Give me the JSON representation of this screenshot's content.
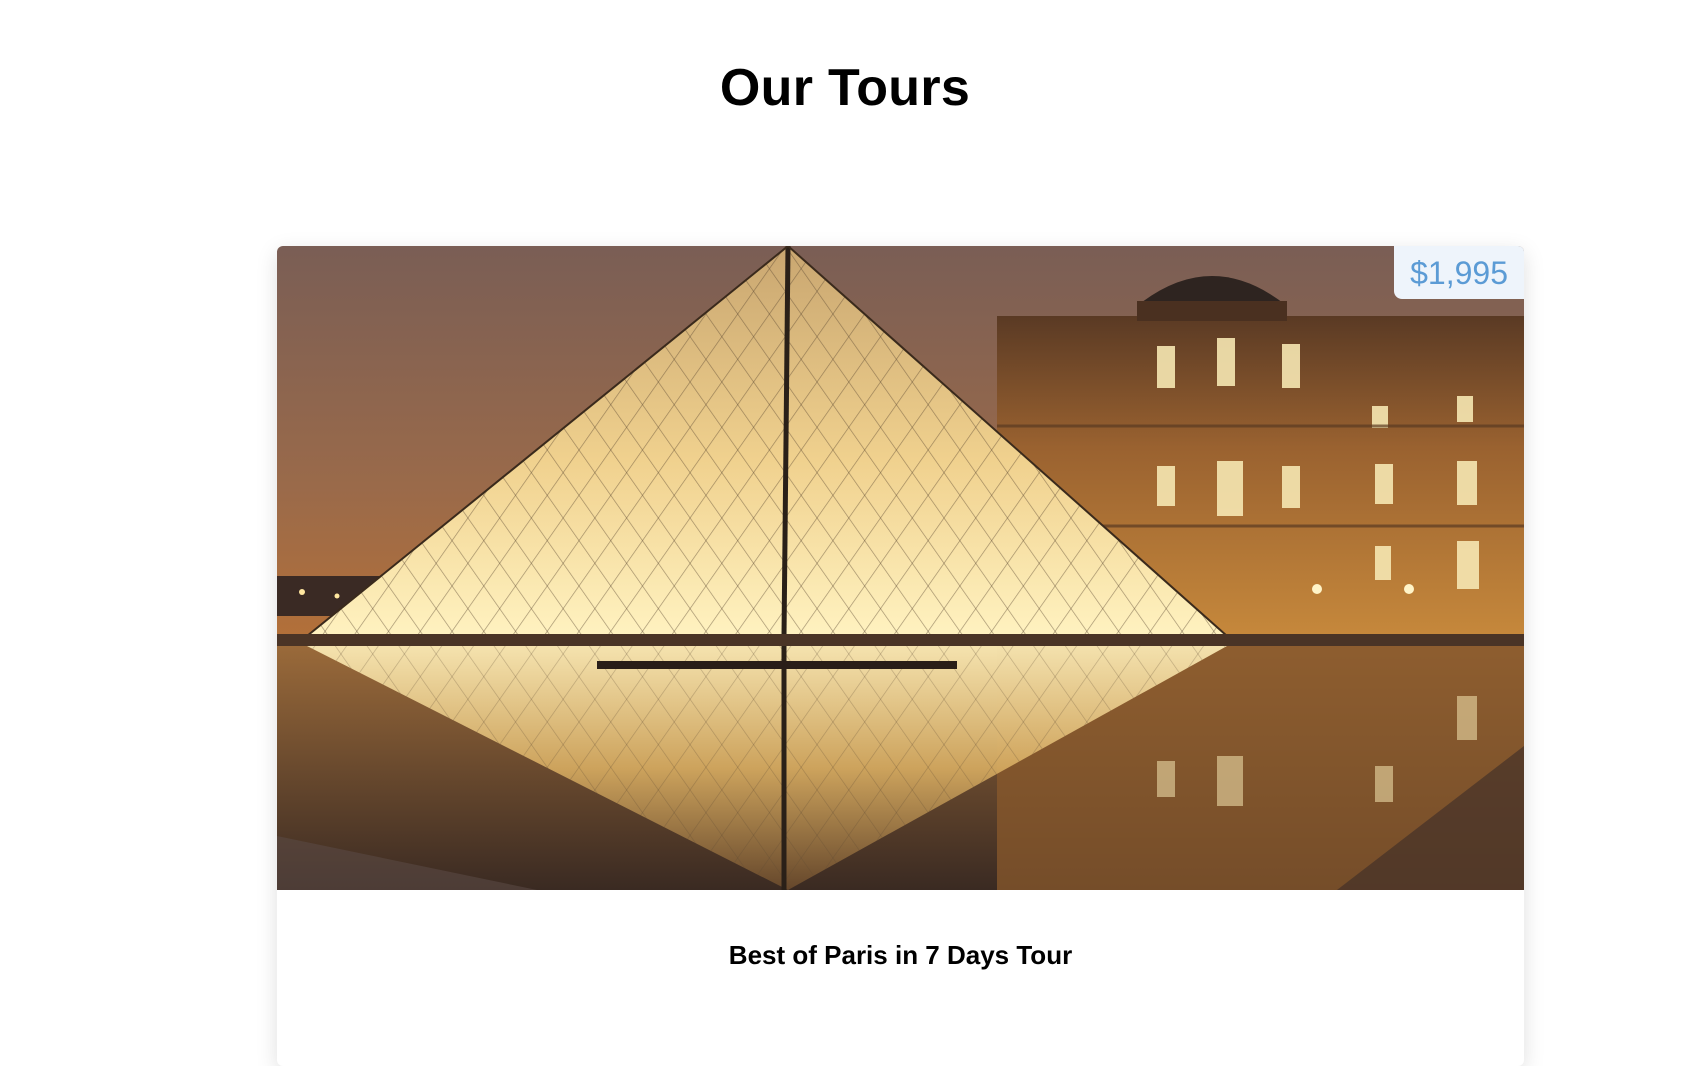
{
  "page": {
    "title": "Our Tours"
  },
  "tour": {
    "name": "Best of Paris in 7 Days Tour",
    "price": "$1,995",
    "image_subject": "Louvre pyramid at night with reflection"
  },
  "colors": {
    "price_text": "#5b9bd5",
    "price_bg": "#eef4fb"
  }
}
